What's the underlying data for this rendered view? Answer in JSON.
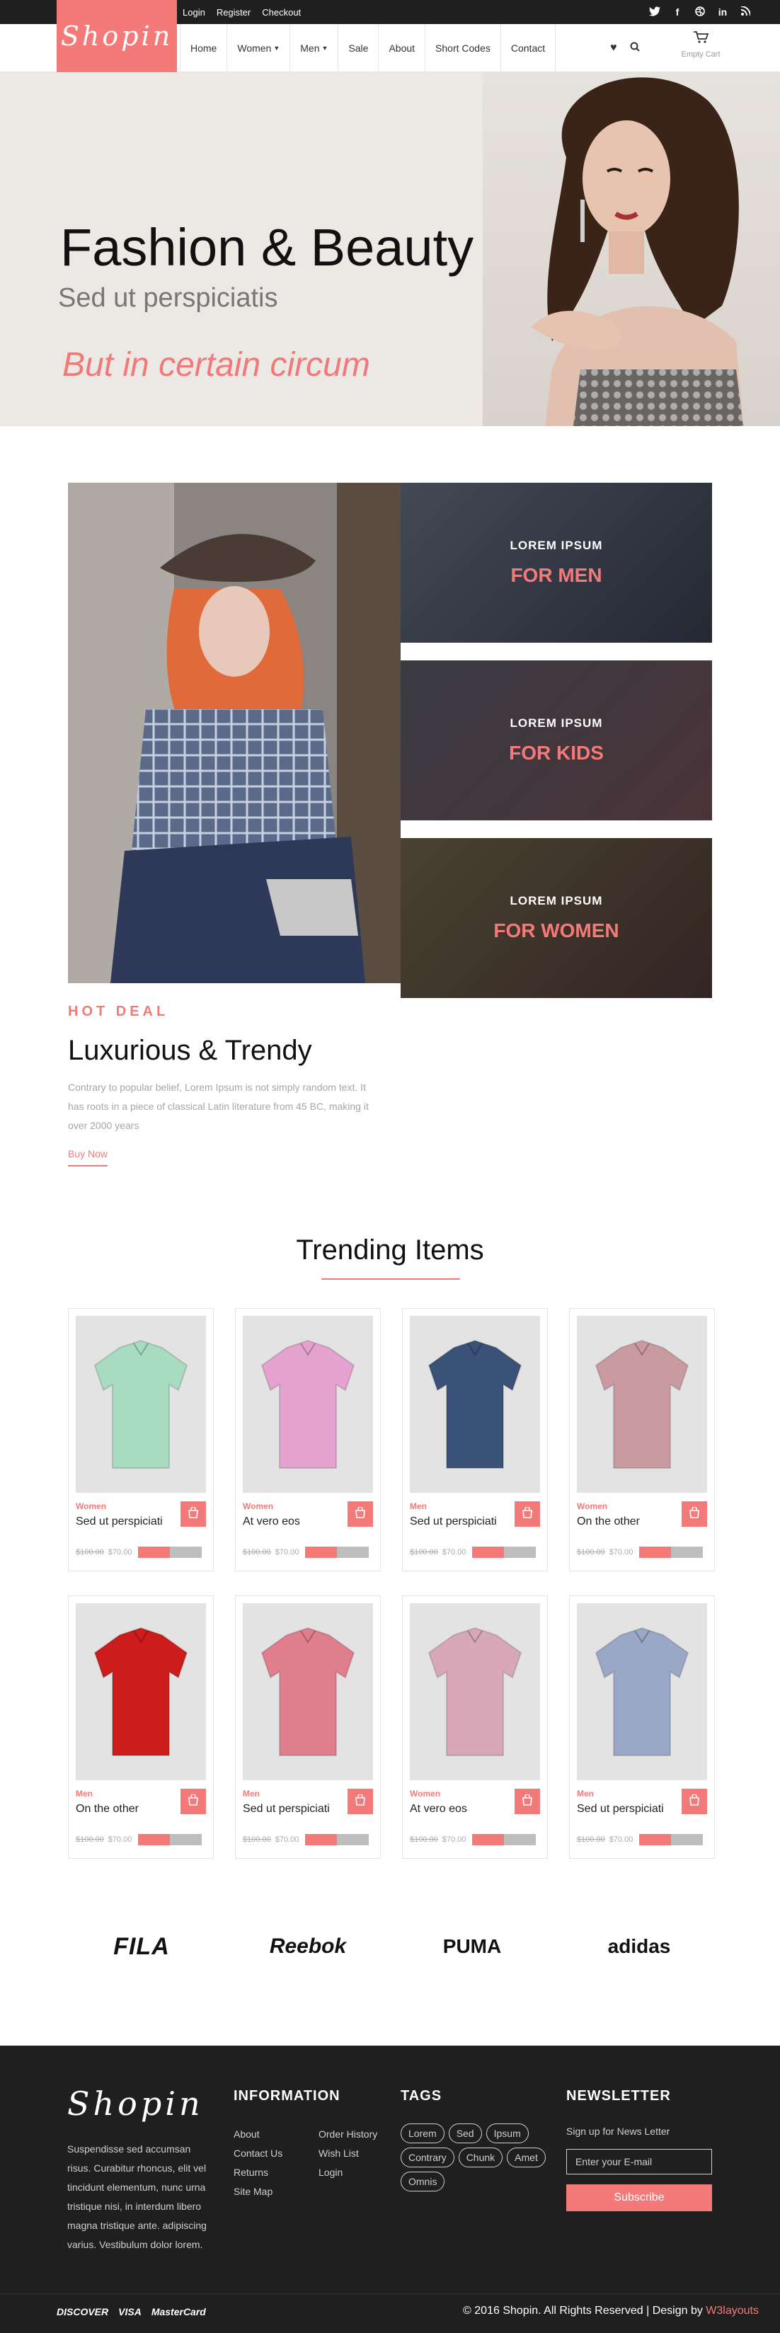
{
  "top_links": [
    "Login",
    "Register",
    "Checkout"
  ],
  "social_icons": [
    "twitter-icon",
    "facebook-icon",
    "dribbble-icon",
    "linkedin-icon",
    "rss-icon"
  ],
  "logo": "Shopin",
  "nav": [
    {
      "label": "Home",
      "dropdown": false
    },
    {
      "label": "Women",
      "dropdown": true
    },
    {
      "label": "Men",
      "dropdown": true
    },
    {
      "label": "Sale",
      "dropdown": false
    },
    {
      "label": "About",
      "dropdown": false
    },
    {
      "label": "Short Codes",
      "dropdown": false
    },
    {
      "label": "Contact",
      "dropdown": false
    }
  ],
  "cart_label": "Empty Cart",
  "hero": {
    "title": "Fashion & Beauty",
    "subtitle": "Sed ut perspiciatis",
    "tagline": "But in certain circum"
  },
  "categories": [
    {
      "small": "LOREM IPSUM",
      "big": "FOR MEN"
    },
    {
      "small": "LOREM IPSUM",
      "big": "FOR KIDS"
    },
    {
      "small": "LOREM IPSUM",
      "big": "FOR WOMEN"
    }
  ],
  "hot_deal": {
    "label": "HOT DEAL",
    "title": "Luxurious & Trendy",
    "text": "Contrary to popular belief, Lorem Ipsum is not simply random text. It has roots in a piece of classical Latin literature from 45 BC, making it over 2000 years",
    "button": "Buy Now"
  },
  "trending_title": "Trending Items",
  "products": [
    {
      "category": "Women",
      "name": "Sed ut perspiciati",
      "old_price": "$100.00",
      "price": "$70.00",
      "color": "#a8dcc0"
    },
    {
      "category": "Women",
      "name": "At vero eos",
      "old_price": "$100.00",
      "price": "$70.00",
      "color": "#e4a3cf"
    },
    {
      "category": "Men",
      "name": "Sed ut perspiciati",
      "old_price": "$100.00",
      "price": "$70.00",
      "color": "#3a5277"
    },
    {
      "category": "Women",
      "name": "On the other",
      "old_price": "$100.00",
      "price": "$70.00",
      "color": "#c99aa0"
    },
    {
      "category": "Men",
      "name": "On the other",
      "old_price": "$100.00",
      "price": "$70.00",
      "color": "#cc1c1c"
    },
    {
      "category": "Men",
      "name": "Sed ut perspiciati",
      "old_price": "$100.00",
      "price": "$70.00",
      "color": "#e07e8e"
    },
    {
      "category": "Women",
      "name": "At vero eos",
      "old_price": "$100.00",
      "price": "$70.00",
      "color": "#d8a8b8"
    },
    {
      "category": "Men",
      "name": "Sed ut perspiciati",
      "old_price": "$100.00",
      "price": "$70.00",
      "color": "#9aa8c8"
    }
  ],
  "brands": [
    "FILA",
    "Reebok",
    "PUMA",
    "adidas"
  ],
  "footer": {
    "logo": "Shopin",
    "description": "Suspendisse sed accumsan risus. Curabitur rhoncus, elit vel tincidunt elementum, nunc urna tristique nisi, in interdum libero magna tristique ante. adipiscing varius. Vestibulum dolor lorem.",
    "information_title": "INFORMATION",
    "info_col1": [
      "About",
      "Contact Us",
      "Returns",
      "Site Map"
    ],
    "info_col2": [
      "Order History",
      "Wish List",
      "Login"
    ],
    "tags_title": "TAGS",
    "tags": [
      "Lorem",
      "Sed",
      "Ipsum",
      "Contrary",
      "Chunk",
      "Amet",
      "Omnis"
    ],
    "newsletter_title": "NEWSLETTER",
    "newsletter_text": "Sign up for News Letter",
    "email_placeholder": "Enter your E-mail",
    "subscribe": "Subscribe",
    "payment": [
      "DISCOVER",
      "VISA",
      "MasterCard"
    ],
    "copyright": "© 2016 Shopin. All Rights Reserved | Design by ",
    "designer": "W3layouts"
  },
  "colors": {
    "accent": "#f47a7a",
    "dark": "#1f1f1f"
  }
}
